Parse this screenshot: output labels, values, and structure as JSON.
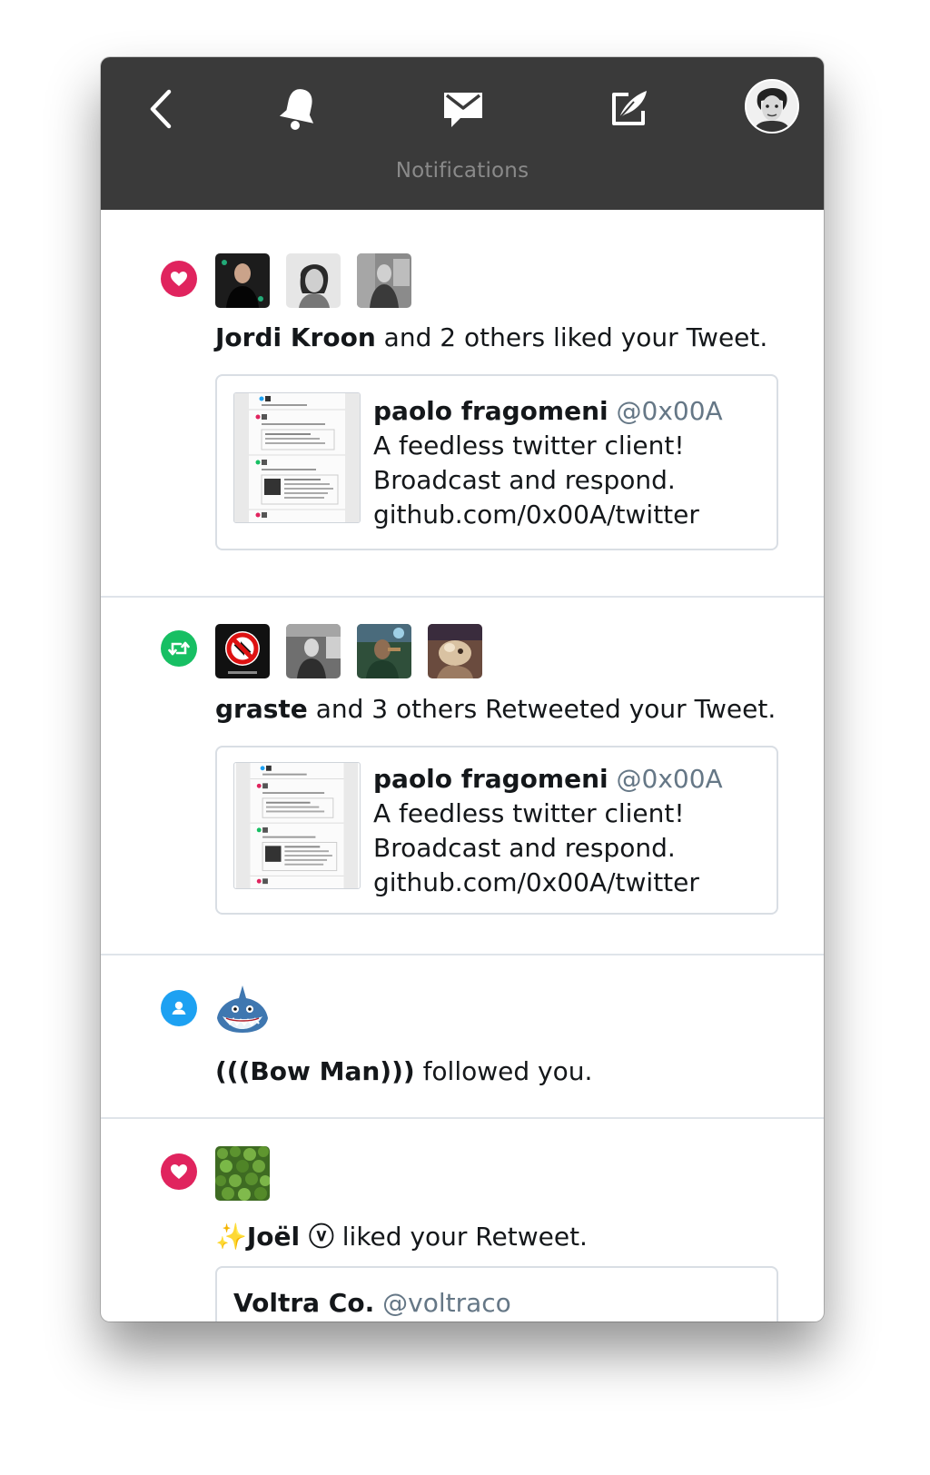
{
  "toolbar": {
    "title": "Notifications",
    "icons": [
      "back-icon",
      "bell-icon",
      "mail-icon",
      "compose-icon",
      "profile-avatar"
    ]
  },
  "colors": {
    "toolbar_bg": "#3a3a3a",
    "like": "#e0245e",
    "retweet": "#17bf63",
    "follow": "#1da1f2",
    "text": "#14171a",
    "muted": "#657786"
  },
  "notifications": [
    {
      "type": "like",
      "actor": "Jordi Kroon",
      "rest": " and 2 others liked your Tweet.",
      "tweet": {
        "name": "paolo fragomeni",
        "handle": "@0x00A",
        "lines": [
          "A feedless twitter client!",
          "Broadcast and respond.",
          "github.com/0x00A/twitter"
        ]
      }
    },
    {
      "type": "retweet",
      "actor": "graste",
      "rest": " and 3 others Retweeted your Tweet.",
      "tweet": {
        "name": "paolo fragomeni",
        "handle": "@0x00A",
        "lines": [
          "A feedless twitter client!",
          "Broadcast and respond.",
          "github.com/0x00A/twitter"
        ]
      }
    },
    {
      "type": "follow",
      "actor": "(((Bow Man)))",
      "rest": " followed you."
    },
    {
      "type": "like",
      "actor_prefix": "✨",
      "actor": "Joël ⓥ",
      "rest": " liked your Retweet.",
      "tweet": {
        "name": "Voltra Co.",
        "handle": "@voltraco"
      }
    }
  ]
}
